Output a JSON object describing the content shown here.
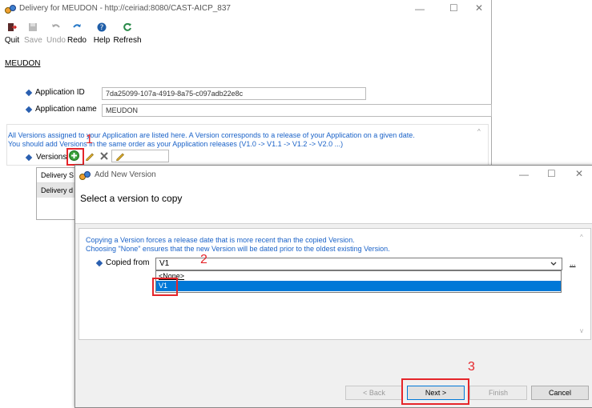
{
  "main_window": {
    "title": "Delivery for MEUDON - http://ceiriad:8080/CAST-AICP_837",
    "controls": {
      "minimize": "—",
      "maximize": "☐",
      "close": "✕"
    }
  },
  "toolbar": {
    "quit": "Quit",
    "save": "Save",
    "undo": "Undo",
    "redo": "Redo",
    "help": "Help",
    "refresh": "Refresh"
  },
  "breadcrumb": "MEUDON",
  "application": {
    "id_label": "Application ID",
    "id_value": "7da25099-107a-4919-8a75-c097adb22e8c",
    "name_label": "Application name",
    "name_value": "MEUDON"
  },
  "versions_info": {
    "line1": "All Versions assigned to your Application are listed here. A Version corresponds to a release of your Application on a given date.",
    "line2": "You should add Versions in the same order as your Application releases (V1.0 -> V1.1 -> V1.2 -> V2.0 ...)",
    "label": "Versions"
  },
  "versions_table": {
    "row1": "Delivery S",
    "row2": "Delivery d"
  },
  "annotations": {
    "one": "1",
    "two": "2",
    "three": "3"
  },
  "dialog": {
    "title": "Add New Version",
    "header": "Select a version to copy",
    "info_line1": "Copying a Version forces a release date that is more recent than the copied Version.",
    "info_line2": "Choosing \"None\" ensures that the new Version will be dated prior to the oldest existing Version.",
    "copied_from_label": "Copied from",
    "selected_value": "V1",
    "browse": "...",
    "options": [
      "<None>",
      "V1"
    ],
    "buttons": {
      "back": "< Back",
      "next": "Next >",
      "finish": "Finish",
      "cancel": "Cancel"
    },
    "controls": {
      "minimize": "—",
      "maximize": "☐",
      "close": "✕"
    }
  },
  "colors": {
    "accent": "#0078d7",
    "annotation": "#e5252a",
    "info_text": "#1a62c8"
  }
}
